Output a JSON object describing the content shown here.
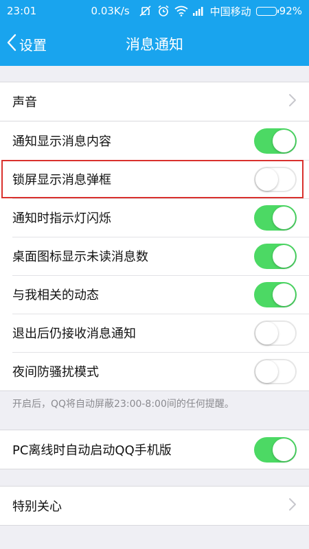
{
  "status_bar": {
    "time": "23:01",
    "network_speed": "0.03K/s",
    "carrier": "中国移动",
    "battery_level": "92%",
    "battery_fraction": 0.92,
    "icons": [
      "mute-icon",
      "alarm-icon",
      "wifi-icon",
      "signal-icon",
      "battery-icon"
    ]
  },
  "nav": {
    "back_label": "设置",
    "title": "消息通知"
  },
  "groups": {
    "sound": {
      "items": [
        {
          "label": "声音",
          "control": "chevron"
        }
      ]
    },
    "main": {
      "items": [
        {
          "label": "通知显示消息内容",
          "control": "toggle",
          "on": true
        },
        {
          "label": "锁屏显示消息弹框",
          "control": "toggle",
          "on": false
        },
        {
          "label": "通知时指示灯闪烁",
          "control": "toggle",
          "on": true
        },
        {
          "label": "桌面图标显示未读消息数",
          "control": "toggle",
          "on": true
        },
        {
          "label": "与我相关的动态",
          "control": "toggle",
          "on": true
        },
        {
          "label": "退出后仍接收消息通知",
          "control": "toggle",
          "on": false
        },
        {
          "label": "夜间防骚扰模式",
          "control": "toggle",
          "on": false
        }
      ],
      "hint": "开启后，QQ将自动屏蔽23:00-8:00间的任何提醒。"
    },
    "pc": {
      "items": [
        {
          "label": "PC离线时自动启动QQ手机版",
          "control": "toggle",
          "on": true
        }
      ]
    },
    "special": {
      "items": [
        {
          "label": "特别关心",
          "control": "chevron"
        }
      ]
    }
  },
  "colors": {
    "primary": "#19a4ee",
    "toggle_on": "#4cd964",
    "highlight": "#d9302c",
    "background": "#efeff4"
  }
}
